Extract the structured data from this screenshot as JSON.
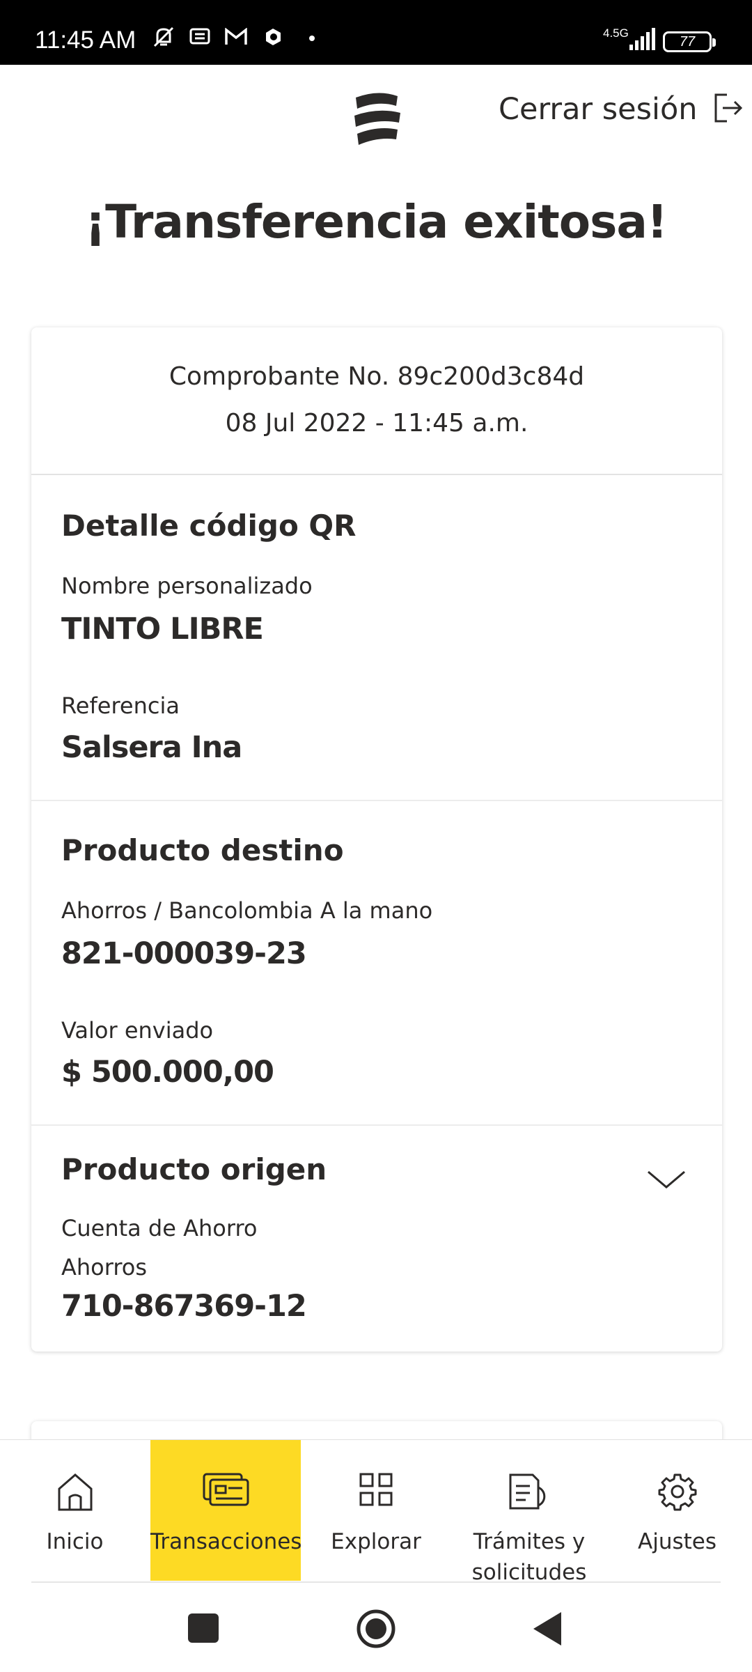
{
  "status_bar": {
    "time": "11:45 AM",
    "network": "4.5G",
    "battery": "77",
    "icons": [
      "bell-off-icon",
      "message-icon",
      "gmail-icon",
      "app-icon",
      "signal-icon",
      "battery-icon"
    ]
  },
  "header": {
    "logo": "bancolombia-logo",
    "logout_label": "Cerrar sesión",
    "logout_icon": "logout-icon"
  },
  "page_title": "¡Transferencia exitosa!",
  "receipt": {
    "number": "Comprobante No. 89c200d3c84d",
    "date": "08 Jul 2022 - 11:45 a.m."
  },
  "qr_detail": {
    "title": "Detalle código QR",
    "name_label": "Nombre personalizado",
    "name_value": "TINTO LIBRE",
    "reference_label": "Referencia",
    "reference_value": "Salsera Ina"
  },
  "destination": {
    "title": "Producto destino",
    "account_label": "Ahorros / Bancolombia A la mano",
    "account_value": "821-000039-23",
    "amount_label": "Valor enviado",
    "amount_value": "$ 500.000,00"
  },
  "origin": {
    "title": "Producto origen",
    "account_name": "Cuenta de Ahorro",
    "account_type": "Ahorros",
    "account_value": "710-867369-12"
  },
  "bottom_nav": {
    "items": [
      {
        "label": "Inicio",
        "icon": "home-icon"
      },
      {
        "label": "Transacciones",
        "icon": "cards-icon"
      },
      {
        "label": "Explorar",
        "icon": "grid-icon"
      },
      {
        "label": "Trámites y solicitudes",
        "label_line1": "Trámites y",
        "label_line2": "solicitudes",
        "icon": "document-icon"
      },
      {
        "label": "Ajustes",
        "icon": "gear-icon"
      }
    ],
    "active_index": 1,
    "active_color": "#fdda24"
  },
  "colors": {
    "text": "#2c2a29",
    "accent": "#fdda24",
    "status_bar": "#000000"
  }
}
